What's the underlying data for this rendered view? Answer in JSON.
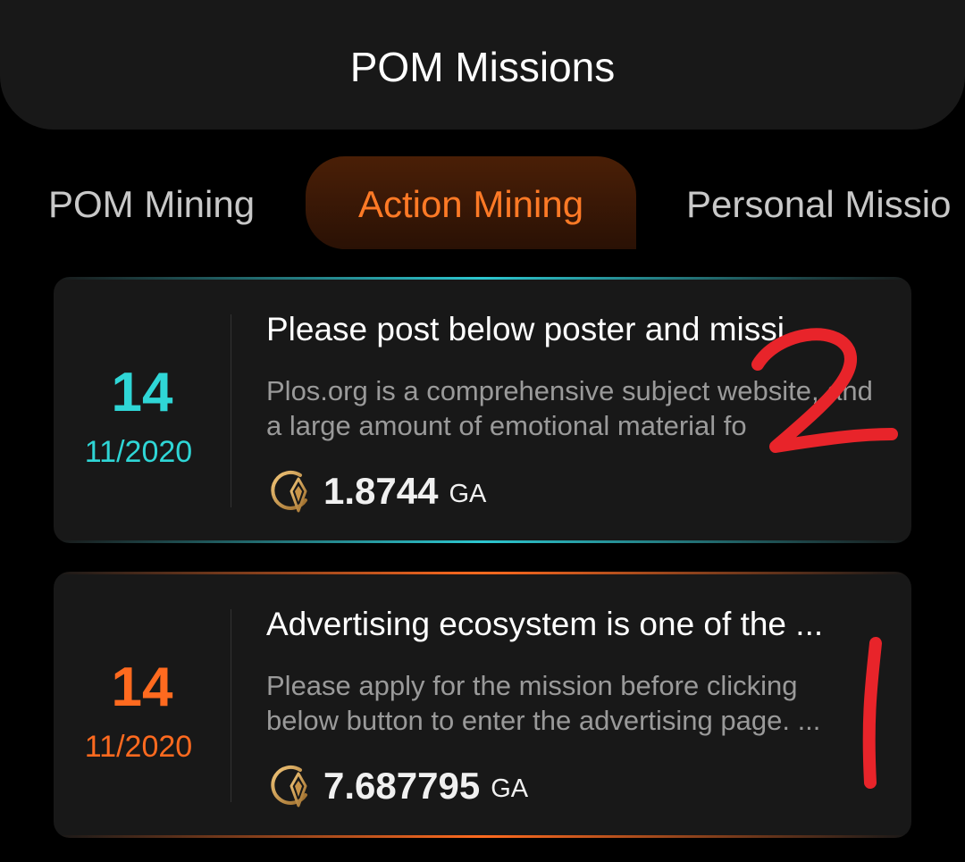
{
  "header": {
    "title": "POM Missions"
  },
  "tabs": [
    {
      "label": "POM Mining",
      "active": false
    },
    {
      "label": "Action Mining",
      "active": true
    },
    {
      "label": "Personal Missio",
      "active": false
    }
  ],
  "missions": [
    {
      "day": "14",
      "month": "11/2020",
      "title": "Please post below poster and missi",
      "description": "Plos.org is a comprehensive subject website, and a large amount of emotional material fo",
      "amount": "1.8744",
      "unit": "GA",
      "accent": "#2fd6d6"
    },
    {
      "day": "14",
      "month": "11/2020",
      "title": "Advertising ecosystem is one of the ...",
      "description": "Please apply for the mission before clicking below button to enter the advertising page. ...",
      "amount": "7.687795",
      "unit": "GA",
      "accent": "#ff6a1f"
    }
  ],
  "annotations": [
    {
      "text": "2"
    },
    {
      "text": "1"
    }
  ],
  "colors": {
    "active_tab": "#ff7a26",
    "annotation": "#e8242a"
  }
}
